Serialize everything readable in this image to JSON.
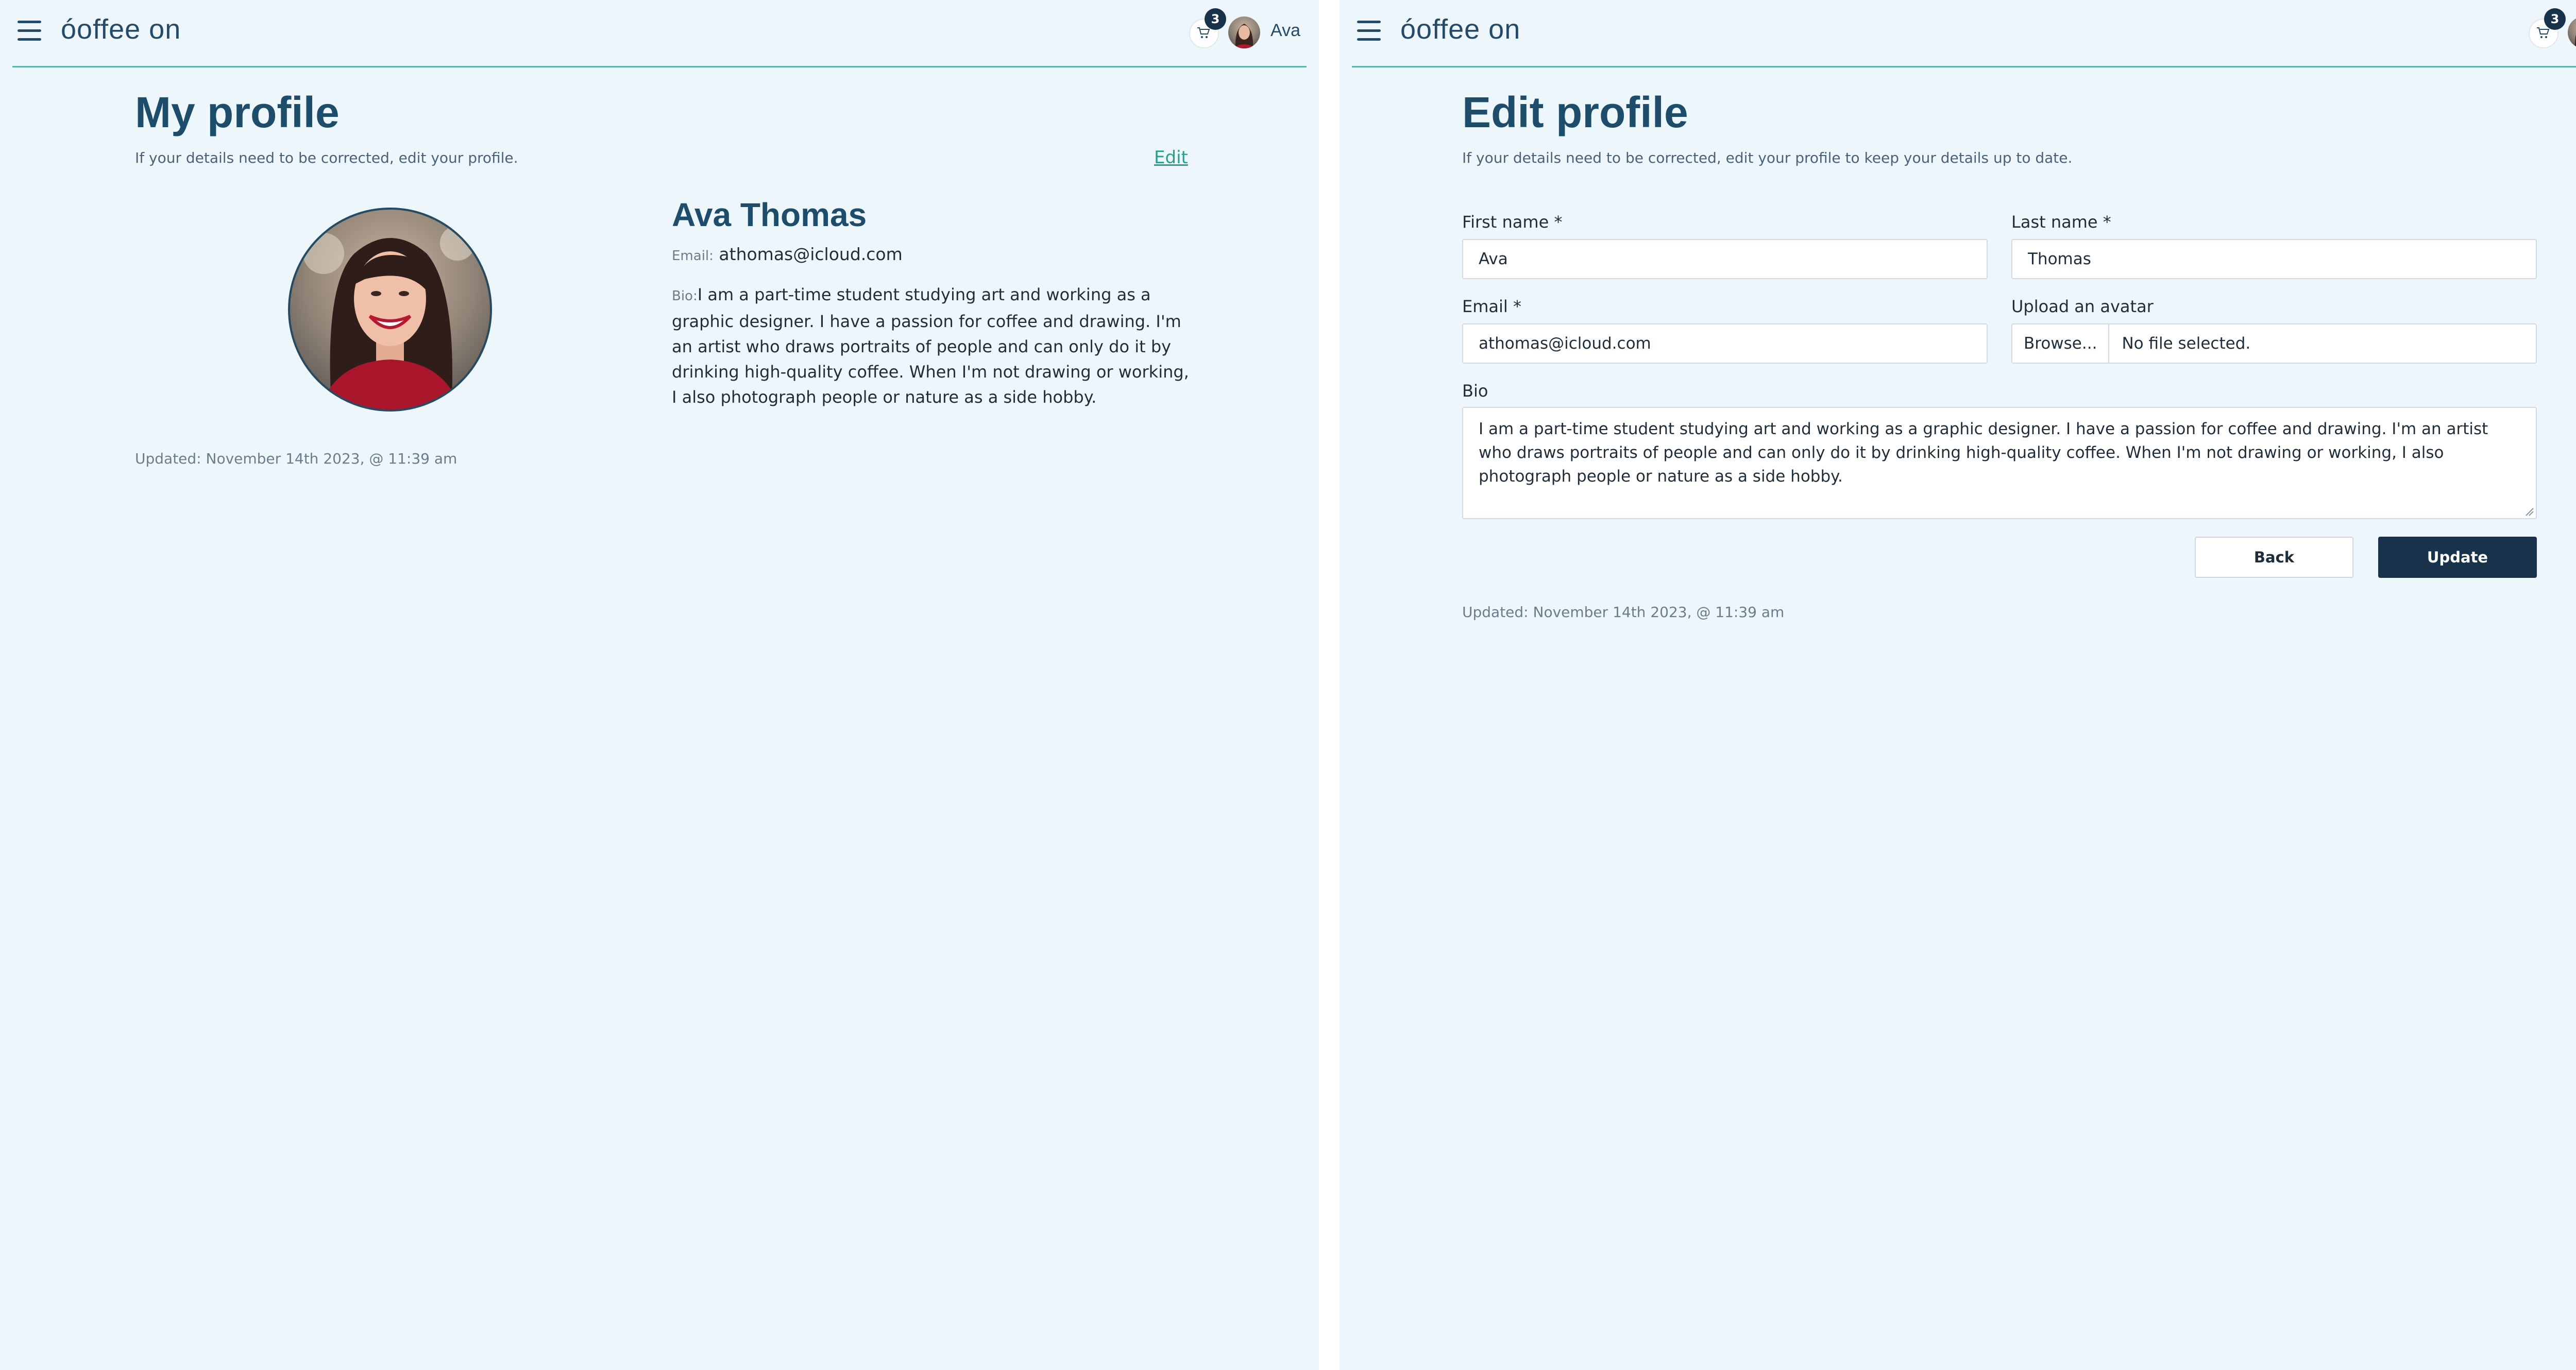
{
  "app": {
    "logo_text": "óoffee on",
    "cart_count": "3",
    "username": "Ava"
  },
  "profile_view": {
    "title": "My profile",
    "subtitle": "If your details need to be corrected, edit your profile.",
    "edit_link": "Edit",
    "name": "Ava Thomas",
    "email_label": "Email:",
    "email": "athomas@icloud.com",
    "bio_label": "Bio:",
    "bio": "I am a part-time student studying art and working as a graphic designer. I have a passion for coffee and drawing. I'm an artist who draws portraits of people and can only do it by drinking high-quality coffee. When I'm not drawing or working, I also photograph people or nature as a side hobby.",
    "updated": "Updated: November 14th 2023, @ 11:39 am"
  },
  "profile_edit": {
    "title": "Edit profile",
    "subtitle": "If your details need to be corrected, edit your profile to keep your details up to date.",
    "first_name_label": "First name *",
    "first_name_value": "Ava",
    "last_name_label": "Last name *",
    "last_name_value": "Thomas",
    "email_label": "Email *",
    "email_value": "athomas@icloud.com",
    "avatar_label": "Upload an avatar",
    "browse_button": "Browse...",
    "file_status": "No file selected.",
    "bio_label": "Bio",
    "bio_value": "I am a part-time student studying art and working as a graphic designer. I have a passion for coffee and drawing. I'm an artist who draws portraits of people and can only do it by drinking high-quality coffee. When I'm not drawing or working, I also photograph people or nature as a side hobby.",
    "back_button": "Back",
    "update_button": "Update",
    "updated": "Updated: November 14th 2023, @ 11:39 am"
  }
}
